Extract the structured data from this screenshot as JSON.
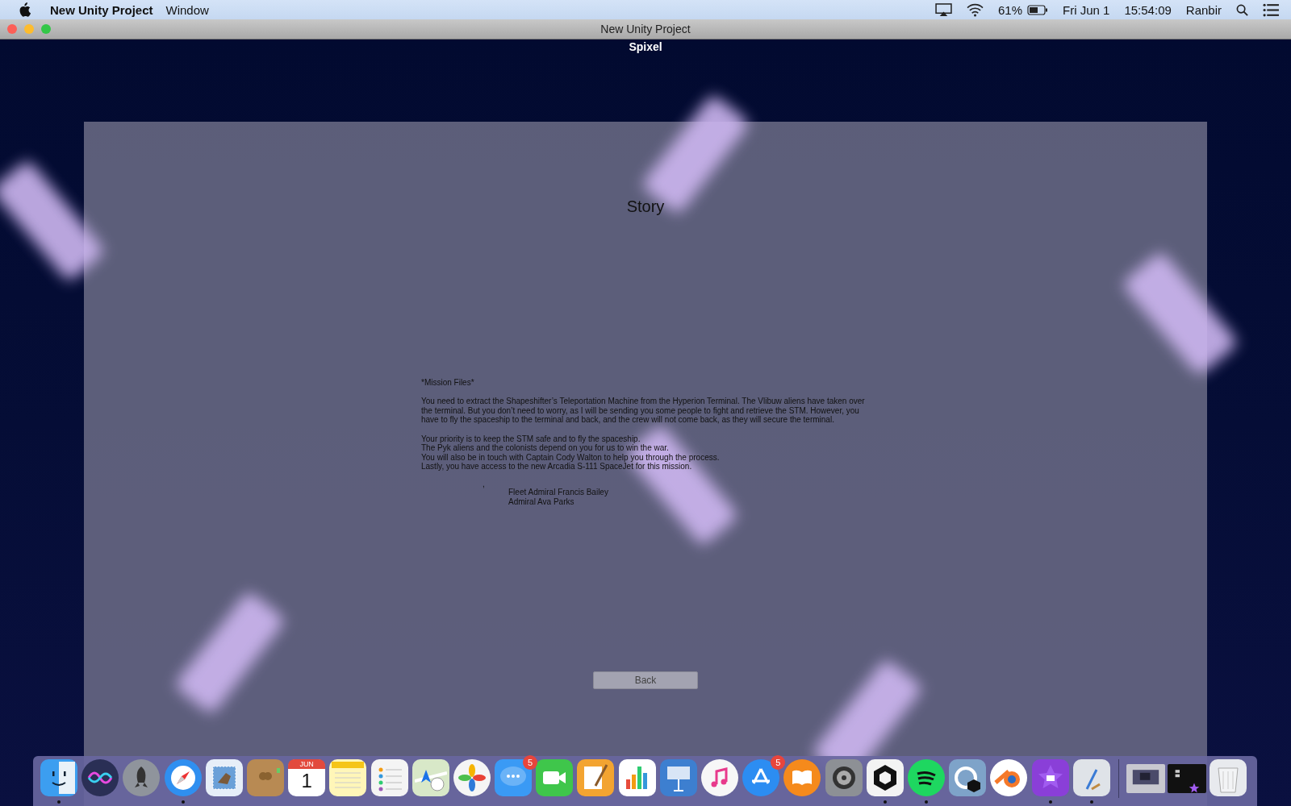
{
  "menu_bar": {
    "app_name": "New Unity Project",
    "menus": [
      "Window"
    ],
    "battery_text": "61%",
    "date": "Fri Jun 1",
    "time": "15:54:09",
    "user": "Ranbir"
  },
  "window": {
    "title": "New Unity Project"
  },
  "game": {
    "title": "Spixel",
    "panel": {
      "heading": "Story",
      "mission_header": "*Mission Files*",
      "paragraph": "You need to extract the Shapeshifter’s Teleportation Machine from the Hyperion Terminal. The Vlibuw aliens have taken over the terminal. But you don’t need to worry, as I will be sending you some people to fight and retrieve the STM. However, you have to fly the spaceship to the terminal and back, and the crew will not come back, as they will secure the terminal.",
      "lines": [
        "Your priority is to keep the STM safe and to fly the spaceship.",
        "The Pyk aliens and the colonists depend on you for us to win the war.",
        "You will also be in touch with Captain Cody Walton to help you through the process.",
        "Lastly, you have access to the new Arcadia S-111 SpaceJet for this mission."
      ],
      "stray_mark": ",",
      "signatures": [
        "Fleet Admiral Francis Bailey",
        "Admiral Ava Parks"
      ],
      "back_button": "Back"
    }
  },
  "dock": {
    "apps": [
      {
        "kind": "finder",
        "running": true
      },
      {
        "kind": "siri",
        "running": false
      },
      {
        "kind": "launchpad",
        "running": false
      },
      {
        "kind": "safari",
        "running": true
      },
      {
        "kind": "mail",
        "running": false
      },
      {
        "kind": "contacts",
        "running": false
      },
      {
        "kind": "calendar",
        "running": false,
        "month": "JUN",
        "day": "1"
      },
      {
        "kind": "notes",
        "running": false
      },
      {
        "kind": "reminders",
        "running": false
      },
      {
        "kind": "maps",
        "running": false
      },
      {
        "kind": "photos",
        "running": false
      },
      {
        "kind": "messages",
        "running": false,
        "badge": "5"
      },
      {
        "kind": "facetime",
        "running": false
      },
      {
        "kind": "pages",
        "running": false
      },
      {
        "kind": "numbers",
        "running": false
      },
      {
        "kind": "keynote",
        "running": false
      },
      {
        "kind": "itunes",
        "running": false
      },
      {
        "kind": "appstore",
        "running": false,
        "badge": "5"
      },
      {
        "kind": "ibooks",
        "running": false
      },
      {
        "kind": "preferences",
        "running": false
      },
      {
        "kind": "unity",
        "running": true
      },
      {
        "kind": "spotify",
        "running": true
      },
      {
        "kind": "unityhub",
        "running": false
      },
      {
        "kind": "blender",
        "running": false
      },
      {
        "kind": "imovie",
        "running": true
      },
      {
        "kind": "xcode",
        "running": true
      }
    ],
    "others": [
      {
        "kind": "window"
      },
      {
        "kind": "window_dark"
      },
      {
        "kind": "trash"
      }
    ]
  }
}
